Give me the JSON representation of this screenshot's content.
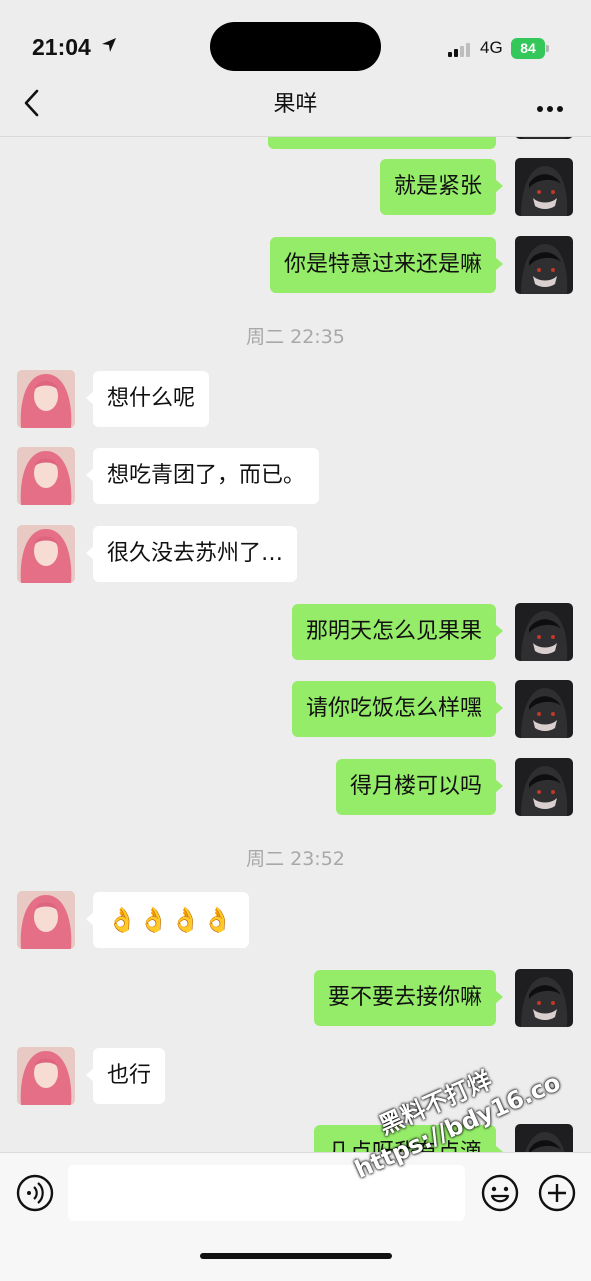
{
  "status_bar": {
    "time": "21:04",
    "network": "4G",
    "battery": "84"
  },
  "header": {
    "title": "果咩"
  },
  "messages": [
    {
      "side": "me",
      "text": "就是紧张"
    },
    {
      "side": "me",
      "text": "你是特意过来还是嘛"
    },
    {
      "timestamp": "周二 22:35"
    },
    {
      "side": "them",
      "text": "想什么呢"
    },
    {
      "side": "them",
      "text": "想吃青团了，而已。"
    },
    {
      "side": "them",
      "text": "很久没去苏州了…"
    },
    {
      "side": "me",
      "text": "那明天怎么见果果"
    },
    {
      "side": "me",
      "text": "请你吃饭怎么样嘿"
    },
    {
      "side": "me",
      "text": "得月楼可以吗"
    },
    {
      "timestamp": "周二 23:52"
    },
    {
      "side": "them",
      "text": "👌👌👌👌"
    },
    {
      "side": "me",
      "text": "要不要去接你嘛"
    },
    {
      "side": "them",
      "text": "也行"
    },
    {
      "side": "me",
      "text": "几点呀我有点滴"
    }
  ],
  "watermark": {
    "line1": "黑料不打烊",
    "line2": "https://bdy16.co"
  },
  "input_bar": {
    "voice_icon": "voice-icon",
    "emoji_icon": "smile-icon",
    "more_icon": "plus-icon"
  }
}
